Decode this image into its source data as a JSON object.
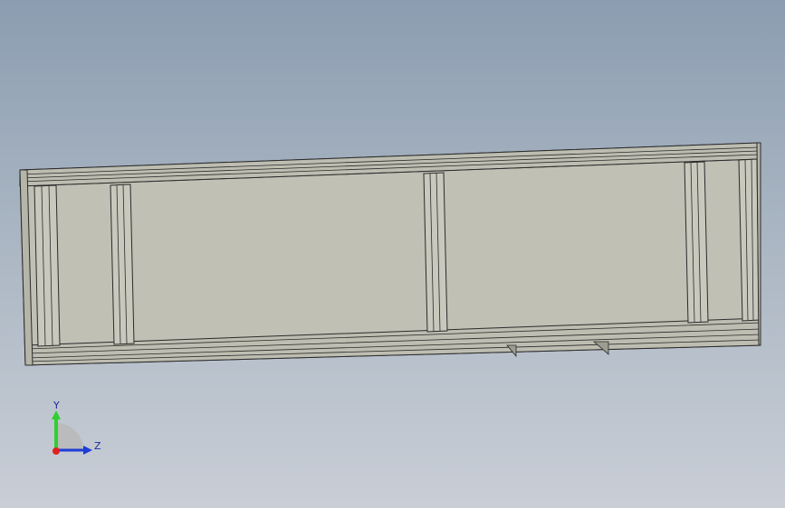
{
  "viewport": {
    "background_top": "#8c9db1",
    "background_bottom": "#c9ced6"
  },
  "model": {
    "face_color": "#c0c0b5",
    "edge_color": "#2b2b2b",
    "frame_color": "#b9b9ad"
  },
  "triad": {
    "y_label": "Y",
    "z_label": "Z",
    "y_color": "#2fd02f",
    "z_color": "#1f3cd6",
    "x_color": "#e02020"
  }
}
